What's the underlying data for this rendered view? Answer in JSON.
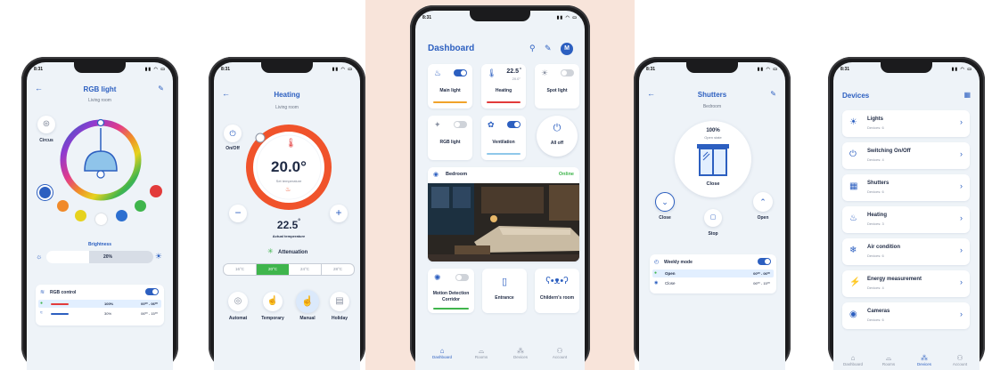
{
  "phone1": {
    "status_time": "8:31",
    "status_icons": "▮▮ ◠ ▭",
    "title": "RGB light",
    "room": "Living room",
    "mode_label": "Circus",
    "brightness_label": "Brightness",
    "brightness_value": "20%",
    "control_label": "RGB control",
    "rows": [
      {
        "pct": "100%",
        "time": "00⁰⁰ - 06⁰⁰",
        "color": "#e23b3b"
      },
      {
        "pct": "30%",
        "time": "06⁰⁰ - 15⁰⁰",
        "color": "#2c5fc0"
      }
    ],
    "swatches": [
      "#2c5fc0",
      "#e23b3b",
      "#f08a2a",
      "#e6d21e",
      "#ffffff",
      "#3fb54c",
      "#2c6fd0"
    ]
  },
  "phone2": {
    "status_time": "8:31",
    "title": "Heating",
    "room": "Living room",
    "onoff_label": "On/Off",
    "set_temp": "20.0°",
    "set_label": "Set temperature",
    "minus": "−",
    "plus": "+",
    "actual_temp": "22.5",
    "actual_unit": "°",
    "actual_label": "Actual temperature",
    "attenuation_label": "Attenuation",
    "temp_options": [
      "16°C",
      "20°C",
      "24°C",
      "28°C"
    ],
    "temp_selected": 1,
    "modes": [
      "Automat",
      "Temporary",
      "Manual",
      "Holiday"
    ]
  },
  "phone3": {
    "status_time": "8:31",
    "title": "Dashboard",
    "avatar": "M",
    "tiles": [
      {
        "label": "Main light",
        "bar": "#f0a22a",
        "icon": "♨"
      },
      {
        "label": "Heating",
        "bar": "#e23b3b",
        "value": "22.5",
        "value_unit": "°",
        "value_sub": "20.0°"
      },
      {
        "label": "Spot light",
        "bar": "#f0d28a",
        "icon": "☀"
      },
      {
        "label": "RGB light",
        "bar": "",
        "icon": "✦"
      },
      {
        "label": "Ventilation",
        "bar": "#8fc8ea",
        "icon": "✿"
      },
      {
        "label": "All off",
        "bar": "",
        "icon": "⏻"
      }
    ],
    "room_label": "Bedroom",
    "room_status": "Online",
    "bottom_tiles": [
      "Motion Detection Corridor",
      "Entrance",
      "Childern's room"
    ],
    "nav": [
      "Dashboard",
      "Rooms",
      "Devices",
      "Account"
    ]
  },
  "phone4": {
    "status_time": "8:31",
    "title": "Shutters",
    "room": "Bedroom",
    "pct": "100%",
    "state": "Open state",
    "close_label": "Close",
    "left_label": "Close",
    "right_label": "Open",
    "stop_label": "Stop",
    "weekly_label": "Weekly mode",
    "rows": [
      {
        "label": "Open",
        "time": "00⁰⁰ - 06⁰⁰"
      },
      {
        "label": "Close",
        "time": "06⁰⁰ - 15⁰⁰"
      }
    ]
  },
  "phone5": {
    "status_time": "8:31",
    "title": "Devices",
    "items": [
      {
        "name": "Lights",
        "count": "Devices: 6",
        "icon": "☀"
      },
      {
        "name": "Switching On/Off",
        "count": "Devices: 4",
        "icon": "⏻"
      },
      {
        "name": "Shutters",
        "count": "Devices: 6",
        "icon": "▦"
      },
      {
        "name": "Heating",
        "count": "Devices: 3",
        "icon": "♨"
      },
      {
        "name": "Air condition",
        "count": "Devices: 6",
        "icon": "❄"
      },
      {
        "name": "Energy measurement",
        "count": "Devices: 4",
        "icon": "⚡"
      },
      {
        "name": "Cameras",
        "count": "Devices: 6",
        "icon": "◉"
      }
    ],
    "nav": [
      "Dashboard",
      "Rooms",
      "Devices",
      "Account"
    ]
  }
}
